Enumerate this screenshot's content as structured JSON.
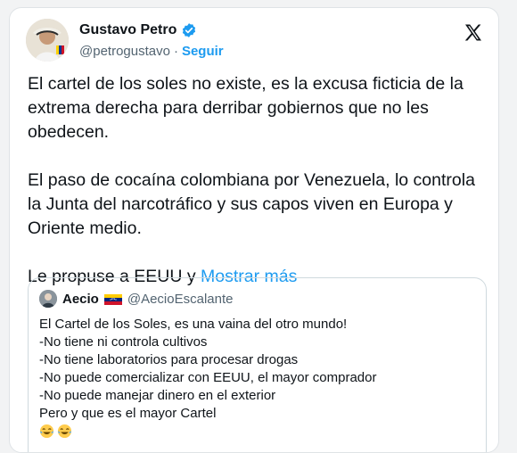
{
  "author": {
    "name": "Gustavo Petro",
    "handle": "@petrogustavo",
    "separator": "·",
    "follow_label": "Seguir",
    "icons": {
      "verified": "verified-badge-icon",
      "platform": "x-logo-icon"
    }
  },
  "tweet": {
    "paragraphs": [
      "El cartel de los soles no existe, es la excusa ficticia de la extrema derecha para derribar gobiernos que no les obedecen.",
      "El paso de cocaína colombiana por Venezuela, lo controla la Junta del narcotráfico y sus capos viven en Europa y Oriente medio."
    ],
    "last_line": "Le propuse a EEUU y",
    "show_more_label": "Mostrar más"
  },
  "quote": {
    "name": "Aecio",
    "flag": "venezuela-flag-icon",
    "handle": "@AecioEscalante",
    "lines": [
      "El Cartel de los Soles, es una vaina del otro mundo!",
      "-No tiene ni controla cultivos",
      "-No tiene laboratorios para procesar drogas",
      "-No puede comercializar con EEUU, el mayor comprador",
      "-No puede manejar dinero en el exterior",
      "Pero y que es el mayor Cartel"
    ],
    "emojis": [
      "😂",
      "😂"
    ]
  },
  "colors": {
    "accent": "#1d9bf0",
    "text": "#0f1419",
    "secondary": "#536471",
    "border": "#cfd9de"
  }
}
